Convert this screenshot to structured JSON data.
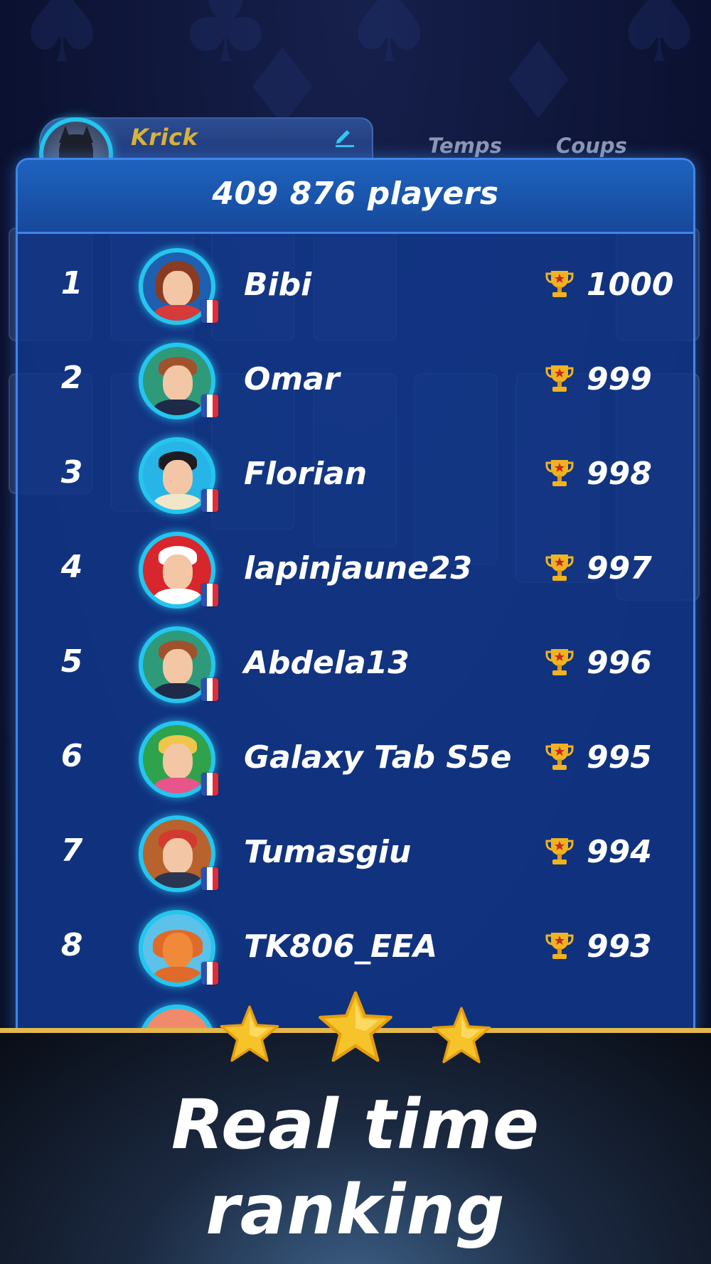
{
  "profile": {
    "name": "Krick"
  },
  "columns": {
    "time_label": "Temps",
    "moves_label": "Coups"
  },
  "leaderboard": {
    "player_count": "409 876   players",
    "rows": [
      {
        "rank": "1",
        "name": "Bibi",
        "score": "1000",
        "country": "France"
      },
      {
        "rank": "2",
        "name": "Omar",
        "score": "999",
        "country": "France"
      },
      {
        "rank": "3",
        "name": "Florian",
        "score": "998",
        "country": "France"
      },
      {
        "rank": "4",
        "name": "lapinjaune23",
        "score": "997",
        "country": "France"
      },
      {
        "rank": "5",
        "name": "Abdela13",
        "score": "996",
        "country": "France"
      },
      {
        "rank": "6",
        "name": "Galaxy Tab S5e",
        "score": "995",
        "country": "France"
      },
      {
        "rank": "7",
        "name": "Tumasgiu",
        "score": "994",
        "country": "France"
      },
      {
        "rank": "8",
        "name": "TK806_EEA",
        "score": "993",
        "country": "France"
      }
    ]
  },
  "banner": {
    "line1": "Real time",
    "line2": "ranking",
    "stars": 3
  },
  "colors": {
    "accent_cyan": "#24c6ef",
    "panel_blue": "#12388c",
    "gold": "#e3b84c",
    "profile_name": "#d8b23b"
  },
  "icons": {
    "edit": "pencil-icon",
    "score": "trophy-icon",
    "flag": "france-flag-icon",
    "rating": "star-icon"
  }
}
